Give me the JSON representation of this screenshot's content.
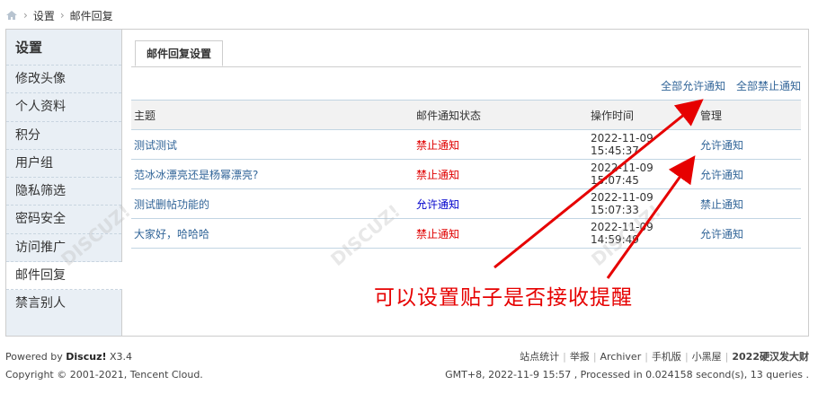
{
  "breadcrumb": {
    "items": [
      "设置",
      "邮件回复"
    ]
  },
  "sidebar": {
    "title": "设置",
    "items": [
      {
        "label": "修改头像"
      },
      {
        "label": "个人资料"
      },
      {
        "label": "积分"
      },
      {
        "label": "用户组"
      },
      {
        "label": "隐私筛选"
      },
      {
        "label": "密码安全"
      },
      {
        "label": "访问推广"
      },
      {
        "label": "邮件回复",
        "active": true
      },
      {
        "label": "禁言别人"
      }
    ]
  },
  "main": {
    "tab": "邮件回复设置",
    "actions": {
      "allow_all": "全部允许通知",
      "deny_all": "全部禁止通知"
    },
    "table": {
      "headers": [
        "主题",
        "邮件通知状态",
        "操作时间",
        "管理"
      ],
      "rows": [
        {
          "subject": "测试测试",
          "status": "禁止通知",
          "status_color": "red",
          "time": "2022-11-09 15:45:37",
          "action": "允许通知"
        },
        {
          "subject": "范冰冰漂亮还是杨幂漂亮?",
          "status": "禁止通知",
          "status_color": "red",
          "time": "2022-11-09 15:07:45",
          "action": "允许通知"
        },
        {
          "subject": "测试删帖功能的",
          "status": "允许通知",
          "status_color": "blue",
          "time": "2022-11-09 15:07:33",
          "action": "禁止通知"
        },
        {
          "subject": "大家好，哈哈哈",
          "status": "禁止通知",
          "status_color": "red",
          "time": "2022-11-09 14:59:49",
          "action": "允许通知"
        }
      ]
    }
  },
  "annotation": {
    "text": "可以设置贴子是否接收提醒"
  },
  "footer": {
    "powered_prefix": "Powered by ",
    "powered_brand": "Discuz!",
    "powered_version": " X3.4",
    "copyright": "Copyright © 2001-2021, Tencent Cloud.",
    "links": [
      "站点统计",
      "举报",
      "Archiver",
      "手机版",
      "小黑屋"
    ],
    "site_name": "2022硬汉发大财",
    "stats": "GMT+8, 2022-11-9 15:57 , Processed in 0.024158 second(s), 13 queries ."
  },
  "colors": {
    "accent_red": "#e60000",
    "link_blue": "#336699",
    "deny_red": "#e00000",
    "allow_blue": "#0000cc"
  }
}
